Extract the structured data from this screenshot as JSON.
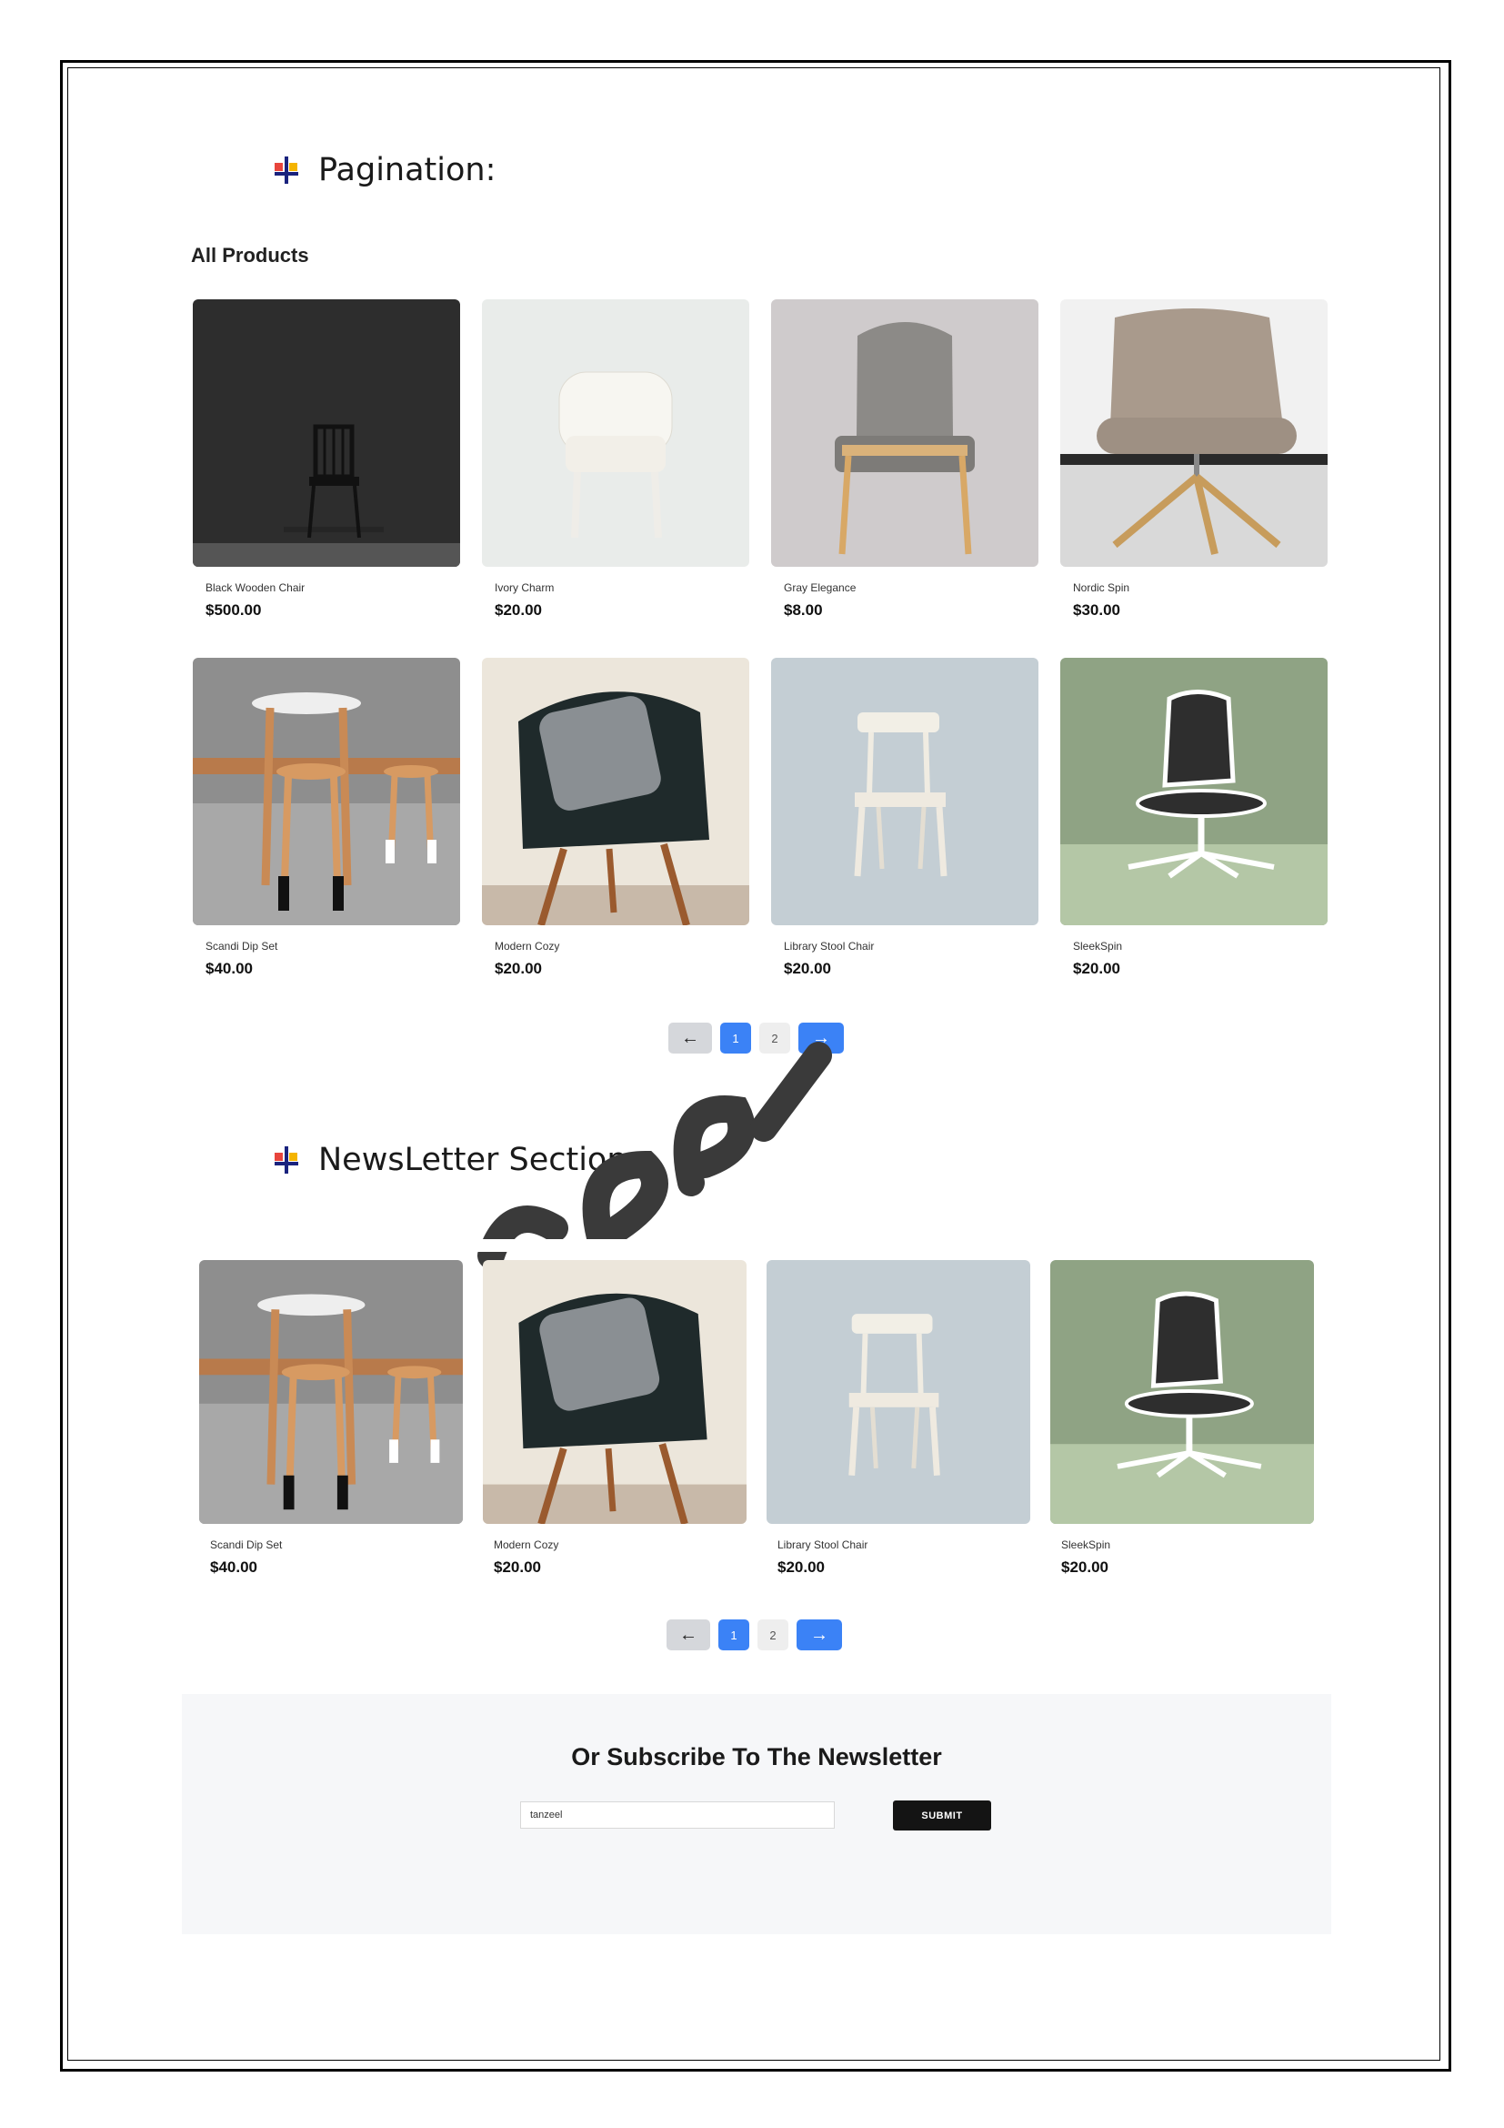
{
  "headings": {
    "pagination": "Pagination:",
    "newsletter_section": "NewsLetter Section:"
  },
  "section_title": "All Products",
  "products_grid": [
    {
      "name": "Black Wooden Chair",
      "price": "$500.00"
    },
    {
      "name": "Ivory Charm",
      "price": "$20.00"
    },
    {
      "name": "Gray Elegance",
      "price": "$8.00"
    },
    {
      "name": "Nordic Spin",
      "price": "$30.00"
    },
    {
      "name": "Scandi Dip Set",
      "price": "$40.00"
    },
    {
      "name": "Modern Cozy",
      "price": "$20.00"
    },
    {
      "name": "Library Stool Chair",
      "price": "$20.00"
    },
    {
      "name": "SleekSpin",
      "price": "$20.00"
    }
  ],
  "products_row": [
    {
      "name": "Scandi Dip Set",
      "price": "$40.00"
    },
    {
      "name": "Modern Cozy",
      "price": "$20.00"
    },
    {
      "name": "Library Stool Chair",
      "price": "$20.00"
    },
    {
      "name": "SleekSpin",
      "price": "$20.00"
    }
  ],
  "pagination": {
    "prev_icon": "arrow-left-icon",
    "pages": [
      "1",
      "2"
    ],
    "active_page": "1",
    "next_icon": "arrow-right-icon",
    "accent": "#3b82f6"
  },
  "newsletter": {
    "title": "Or Subscribe To The Newsletter",
    "input_value": "tanzeel",
    "submit_label": "SUBMIT"
  }
}
